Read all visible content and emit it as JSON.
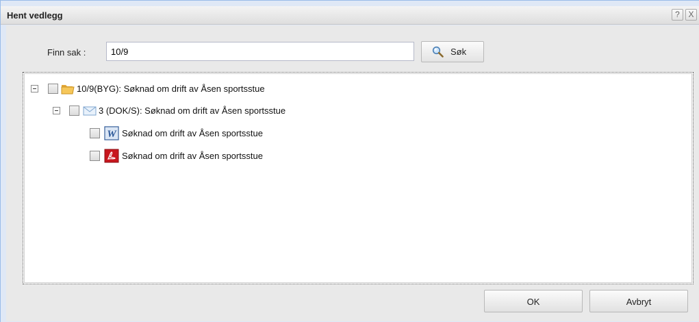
{
  "dialog": {
    "title": "Hent vedlegg",
    "help_label": "?",
    "close_label": "X"
  },
  "search": {
    "label": "Finn sak :",
    "value": "10/9",
    "button_label": "Søk"
  },
  "tree": {
    "case": {
      "label": "10/9(BYG): Søknad om drift av Åsen sportsstue",
      "icon": "folder-icon",
      "expanded": true,
      "checked": false
    },
    "document": {
      "label": "3 (DOK/S): Søknad om drift av Åsen sportsstue",
      "icon": "envelope-icon",
      "expanded": true,
      "checked": false
    },
    "files": [
      {
        "label": "Søknad om drift av Åsen sportsstue",
        "icon": "word-document-icon",
        "checked": false
      },
      {
        "label": "Søknad om drift av Åsen sportsstue",
        "icon": "pdf-document-icon",
        "checked": false
      }
    ]
  },
  "footer": {
    "ok_label": "OK",
    "cancel_label": "Avbryt"
  },
  "colors": {
    "titlebar": "#e6e6e6",
    "body": "#e9e9e9",
    "folder": "#f6c75a",
    "word": "#2b5797",
    "pdf": "#c8161d"
  }
}
